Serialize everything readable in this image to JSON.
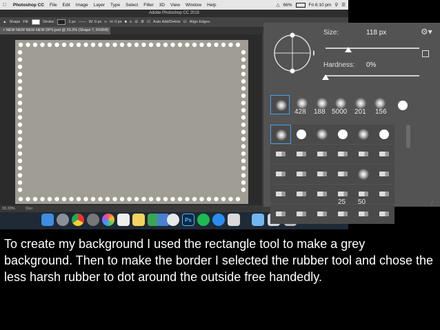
{
  "menubar": {
    "app": "Photoshop CC",
    "items": [
      "File",
      "Edit",
      "Image",
      "Layer",
      "Type",
      "Select",
      "Filter",
      "3D",
      "View",
      "Window",
      "Help"
    ],
    "battery": "66%",
    "clock": "Fri 6:10 pm"
  },
  "window_title": "Adobe Photoshop CC 2015",
  "options_bar": {
    "tool": "Shape",
    "fill_label": "Fill:",
    "stroke_label": "Stroke:",
    "stroke_size": "1 px",
    "w_label": "W: 0 px",
    "h_label": "H: 0 px",
    "auto_add": "Auto Add/Delete",
    "align_edges": "Align Edges"
  },
  "doc_tab": "NEW NEW NEW NEW DPS.psd @ 33.3% (Shape 7, RGB/8) *",
  "status": {
    "zoom": "33.33%",
    "doc": "Doc:"
  },
  "brush_panel": {
    "size_label": "Size:",
    "size_value": "118 px",
    "hardness_label": "Hardness:",
    "hardness_value": "0%",
    "size_fraction": 0.24,
    "hardness_fraction": 0.0,
    "recent_sizes": [
      "428",
      "188",
      "5000",
      "201",
      "156"
    ],
    "grid_numbers": [
      "25",
      "50"
    ]
  },
  "dock": {
    "ps_label": "Ps"
  },
  "caption": "To create my background I used the rectangle tool to make a grey background. Then to make the border I selected the rubber tool and chose the less harsh rubber to dot around the outside free handedly."
}
